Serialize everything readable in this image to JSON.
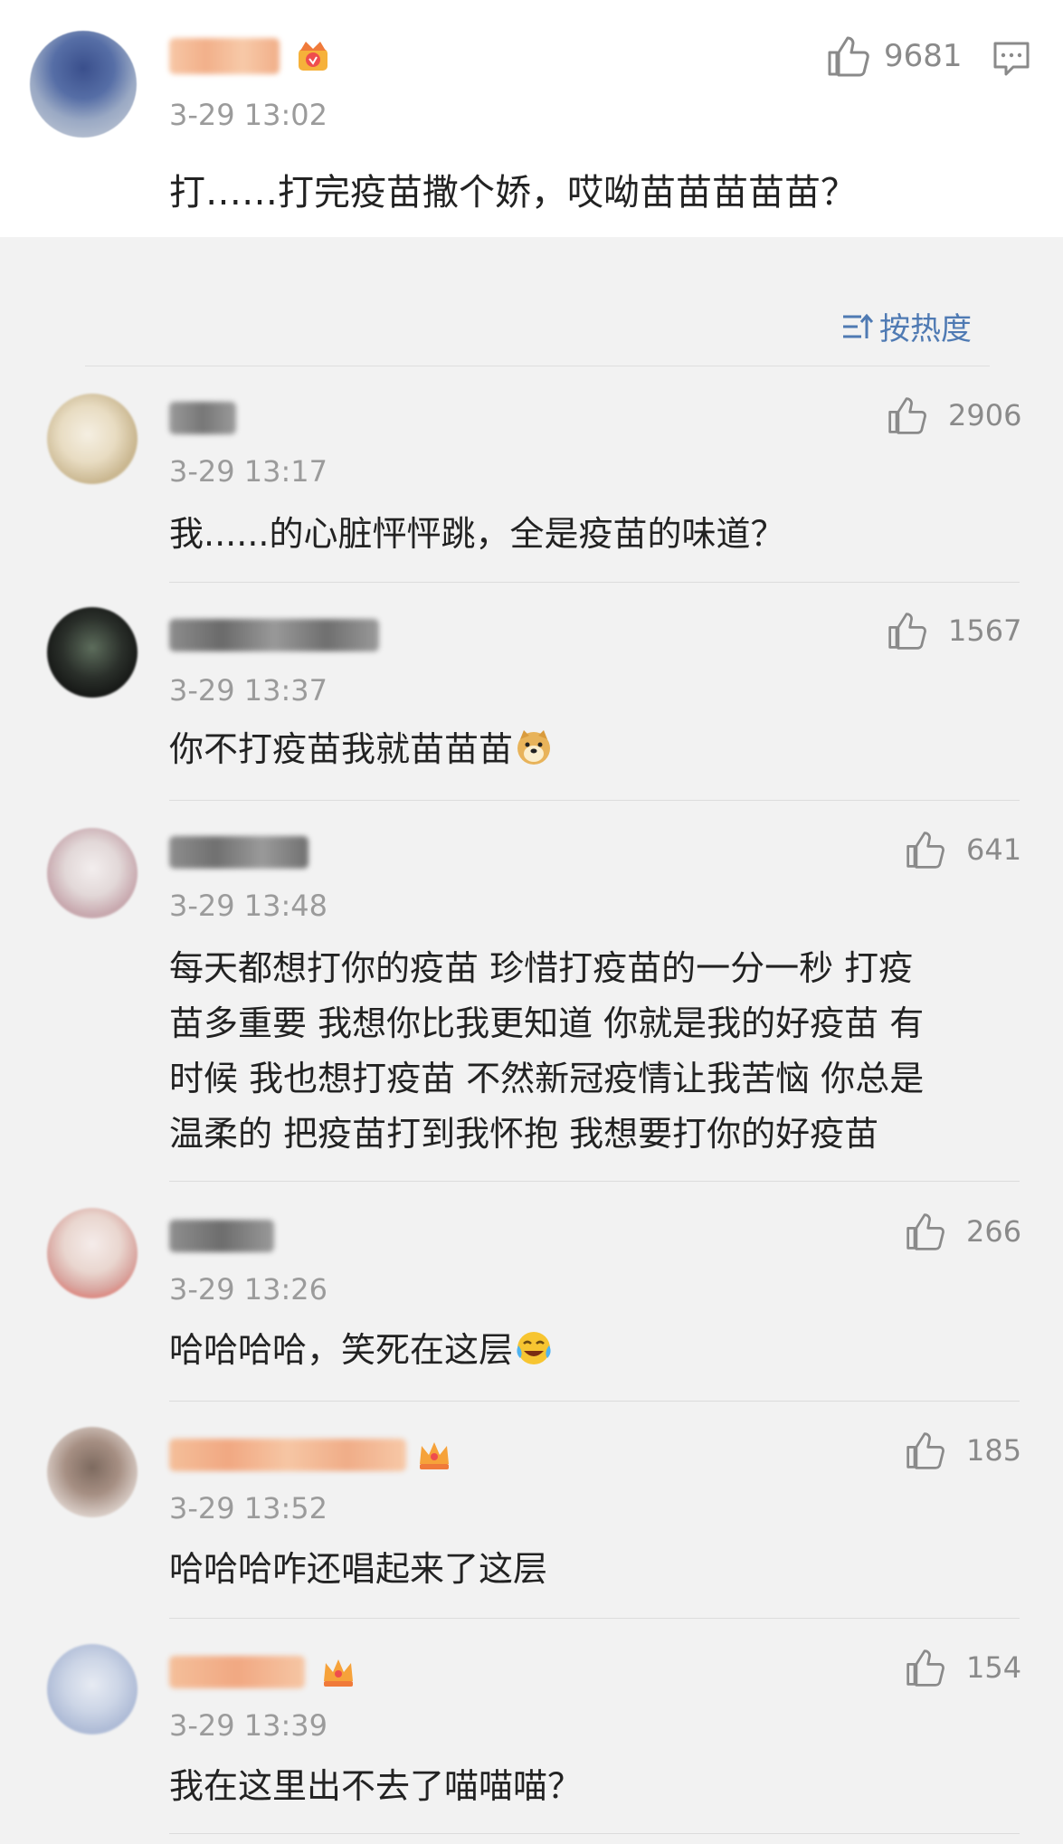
{
  "main_comment": {
    "time": "3-29 13:02",
    "text": "打……打完疫苗撒个娇，哎呦苗苗苗苗苗？",
    "likes": "9681"
  },
  "sort_label": "按热度",
  "replies": [
    {
      "time": "3-29 13:17",
      "text": "我......的心脏怦怦跳，全是疫苗的味道？",
      "likes": "2906"
    },
    {
      "time": "3-29 13:37",
      "text": "你不打疫苗我就苗苗苗",
      "likes": "1567",
      "emoji": "doge-emoji"
    },
    {
      "time": "3-29 13:48",
      "text_lines": [
        "每天都想打你的疫苗 珍惜打疫苗的一分一秒 打疫",
        "苗多重要 我想你比我更知道 你就是我的好疫苗 有",
        "时候 我也想打疫苗 不然新冠疫情让我苦恼 你总是",
        "温柔的 把疫苗打到我怀抱 我想要打你的好疫苗"
      ],
      "likes": "641"
    },
    {
      "time": "3-29 13:26",
      "text": "哈哈哈哈，笑死在这层",
      "likes": "266",
      "emoji": "laugh-cry-emoji"
    },
    {
      "time": "3-29 13:52",
      "text": "哈哈哈咋还唱起来了这层",
      "likes": "185"
    },
    {
      "time": "3-29 13:39",
      "text": "我在这里出不去了喵喵喵？",
      "likes": "154"
    }
  ],
  "colors": {
    "accent": "#4f7ab3",
    "meta": "#9b9b9b",
    "background": "#f2f2f2"
  }
}
